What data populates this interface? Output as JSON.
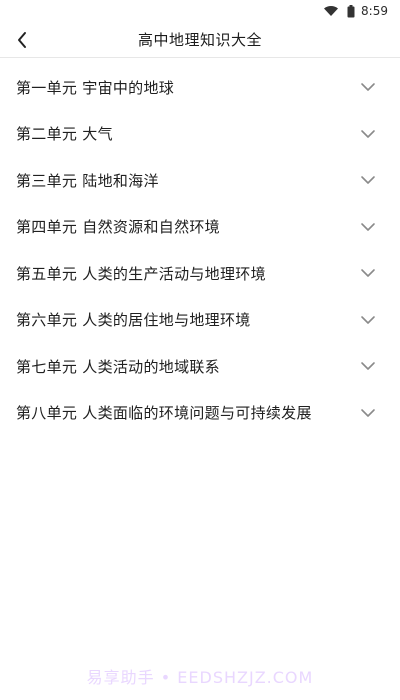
{
  "status_bar": {
    "time": "8:59",
    "icons": [
      "wifi-icon",
      "battery-icon"
    ]
  },
  "app_bar": {
    "back_icon": "chevron-left-icon",
    "title": "高中地理知识大全"
  },
  "units": [
    {
      "label": "第一单元 宇宙中的地球",
      "icon": "chevron-down-icon"
    },
    {
      "label": "第二单元 大气",
      "icon": "chevron-down-icon"
    },
    {
      "label": "第三单元 陆地和海洋",
      "icon": "chevron-down-icon"
    },
    {
      "label": "第四单元 自然资源和自然环境",
      "icon": "chevron-down-icon"
    },
    {
      "label": "第五单元 人类的生产活动与地理环境",
      "icon": "chevron-down-icon"
    },
    {
      "label": "第六单元 人类的居住地与地理环境",
      "icon": "chevron-down-icon"
    },
    {
      "label": "第七单元 人类活动的地域联系",
      "icon": "chevron-down-icon"
    },
    {
      "label": "第八单元 人类面临的环境问题与可持续发展",
      "icon": "chevron-down-icon"
    }
  ],
  "watermark": {
    "text": "易享助手 • EEDSHZJZ.COM"
  },
  "colors": {
    "background": "#ffffff",
    "text": "#202020",
    "chevron": "#8a8a8a",
    "watermark": "#e9d7ff"
  }
}
